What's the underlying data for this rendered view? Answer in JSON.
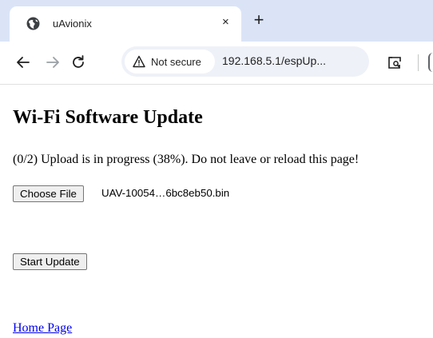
{
  "browser": {
    "tab": {
      "title": "uAvionix",
      "close_glyph": "×",
      "favicon": "globe-icon"
    },
    "new_tab_glyph": "+",
    "toolbar": {
      "back_icon": "arrow-left-icon",
      "forward_icon": "arrow-right-icon",
      "reload_icon": "reload-icon",
      "security_label": "Not secure",
      "security_icon": "warning-triangle-icon",
      "url": "192.168.5.1/espUp...",
      "page_info_icon": "search-page-icon"
    }
  },
  "page": {
    "title": "Wi-Fi Software Update",
    "status": "(0/2) Upload is in progress (38%). Do not leave or reload this page!",
    "file_input": {
      "button_label": "Choose File",
      "file_name": "UAV-10054…6bc8eb50.bin"
    },
    "start_button_label": "Start Update",
    "home_link": "Home Page"
  },
  "colors": {
    "tabstrip_bg": "#dbe4f7",
    "omnibox_bg": "#eef1f8",
    "link": "#0000ee"
  }
}
